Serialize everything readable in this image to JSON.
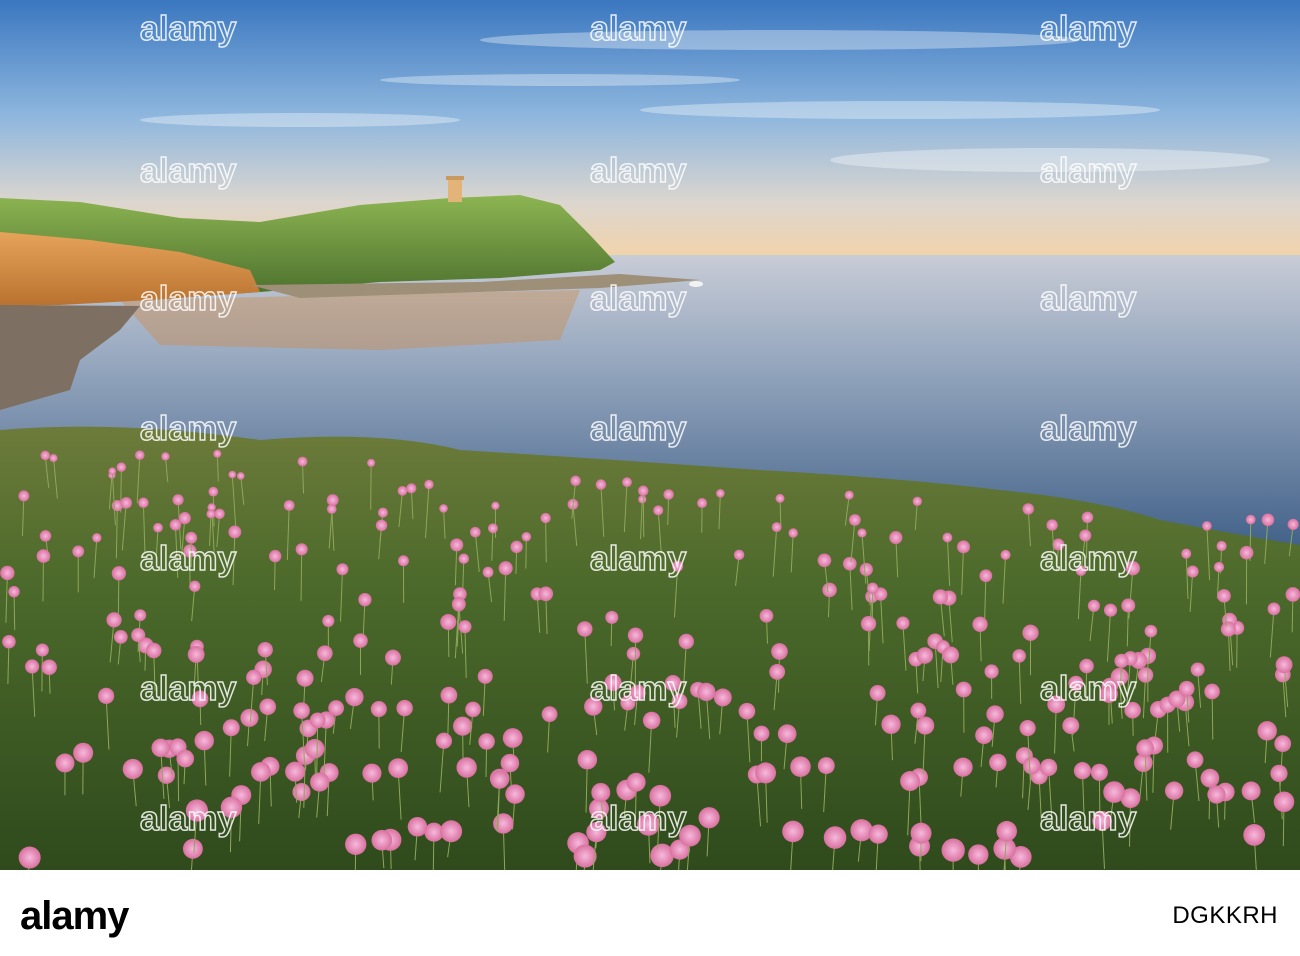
{
  "photo": {
    "subject": "",
    "colors": {
      "sky_top": "#3f7dc4",
      "sky_mid": "#9cc0e0",
      "sky_horizon": "#f4d8b0",
      "sea_far": "#b7c3d3",
      "sea_near": "#4f6f95",
      "hill": "#7fa64a",
      "cliff": "#d9903f",
      "grass": "#3e5e24",
      "flower": "#e68fc0"
    }
  },
  "watermark": {
    "text": "alamy",
    "color": "#ffffff"
  },
  "banner": {
    "brand": "alamy",
    "image_id": "DGKKRH",
    "background": "#ffffff",
    "text_color": "#000000"
  }
}
